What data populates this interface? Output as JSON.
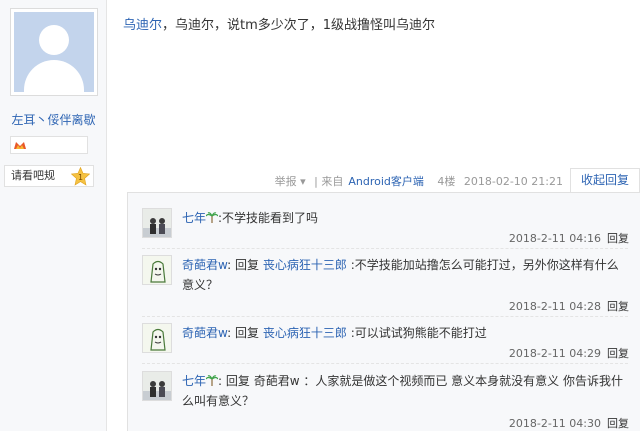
{
  "user": {
    "name": "左耳丶俀伴离歇",
    "forum_title": "请看吧规",
    "forum_level": "1"
  },
  "post": {
    "mention": "乌迪尔",
    "text": "，乌迪尔，说tm多少次了，1级战撸怪叫乌迪尔",
    "report": "举报 ▾",
    "source_prefix": "| 来自",
    "source_client": "Android客户端",
    "floor": "4楼",
    "time": "2018-02-10 21:21",
    "fold_reply": "收起回复"
  },
  "replies": [
    {
      "user": "七年",
      "reply_word": "",
      "target": "",
      "text": ":不学技能看到了吗",
      "time": "2018-2-11 04:16",
      "action": "回复"
    },
    {
      "user": "奇葩君w",
      "reply_word": ": 回复",
      "target": "丧心病狂十三郎",
      "text": ":不学技能加站撸怎么可能打过，另外你这样有什么意义？",
      "time": "2018-2-11 04:28",
      "action": "回复"
    },
    {
      "user": "奇葩君w",
      "reply_word": ": 回复",
      "target": "丧心病狂十三郎",
      "text": ":可以试试狗熊能不能打过",
      "time": "2018-2-11 04:29",
      "action": "回复"
    },
    {
      "user": "七年",
      "reply_word": ": 回复",
      "target": "奇葩君w",
      "text": "：人家就是做这个视频而已 意义本身就没有意义 你告诉我什么叫有意义？",
      "time": "2018-2-11 04:30",
      "action": "回复"
    }
  ],
  "colors": {
    "link": "#2d64b3",
    "muted": "#999999",
    "panel": "#f7f8fa",
    "border": "#e1e1e1"
  }
}
